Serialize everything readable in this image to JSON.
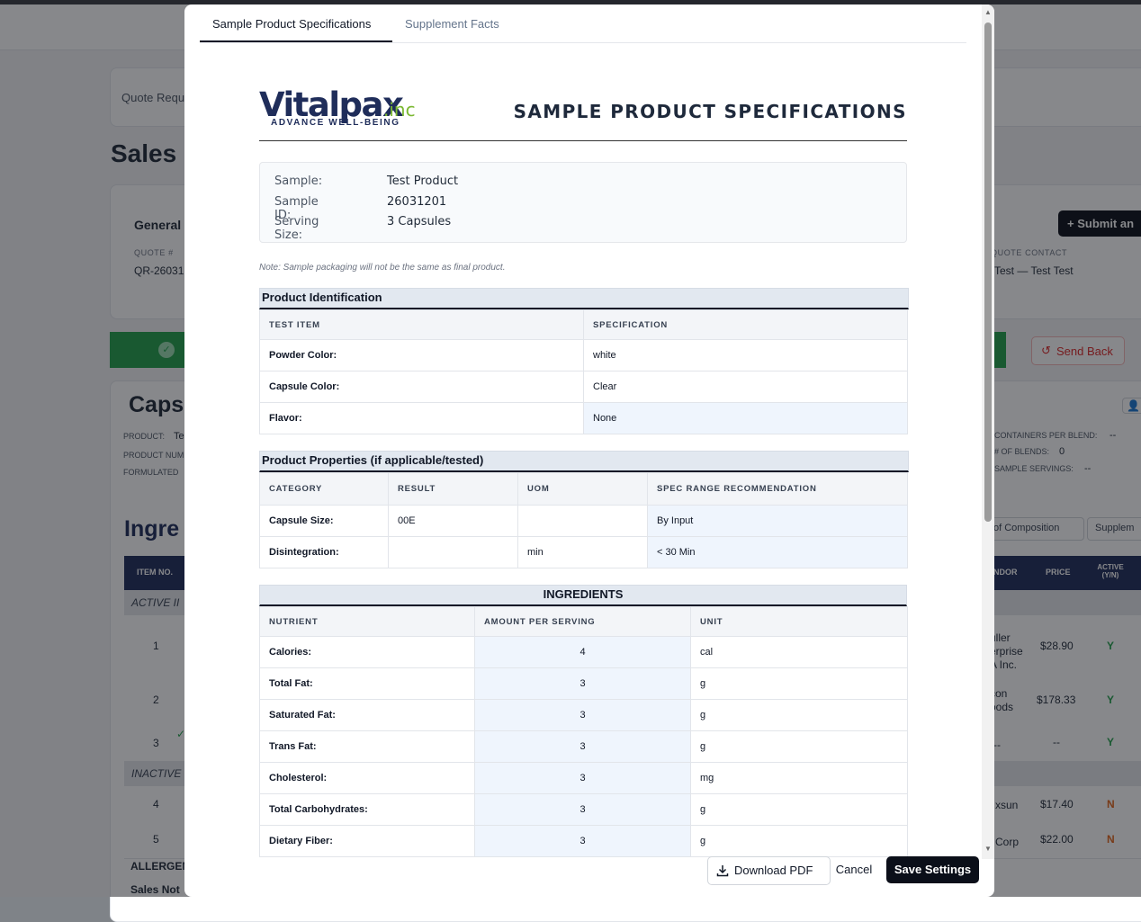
{
  "background": {
    "breadcrumb": "Quote Reque",
    "page_title": "Sales C",
    "general_label": "General",
    "quote_no_label": "QUOTE #",
    "quote_no_value": "QR-26031",
    "quote_contact_label": "QUOTE CONTACT",
    "quote_contact_value": "Test — Test Test",
    "submit_button": "+ Submit an",
    "send_back_button": "Send Back",
    "caps_title": "Caps",
    "product_label": "PRODUCT:",
    "product_value": "Te",
    "product_num_label": "PRODUCT NUM",
    "formulated_label": "FORMULATED",
    "containers_label": "CONTAINERS PER BLEND:",
    "containers_value": "--",
    "blends_label": "# OF BLENDS:",
    "blends_value": "0",
    "sample_servings_label": "SAMPLE SERVINGS:",
    "sample_servings_value": "--",
    "ingredients_title": "Ingre",
    "composition_btn": "of Composition",
    "supplement_btn": "Supplem",
    "col_item_no": "ITEM NO.",
    "col_vendor": "NDOR",
    "col_price": "PRICE",
    "col_active": "ACTIVE (Y/N)",
    "active_group": "ACTIVE II",
    "inactive_group": "INACTIVE",
    "rows": [
      {
        "no": "1",
        "vendor": "uller erprise A Inc.",
        "price": "$28.90",
        "active": "Y"
      },
      {
        "no": "2",
        "vendor": "con oods",
        "price": "$178.33",
        "active": "Y"
      },
      {
        "no": "3",
        "vendor": "--",
        "price": "--",
        "active": "Y"
      },
      {
        "no": "4",
        "vendor": "xsun",
        "price": "$17.40",
        "active": "N"
      },
      {
        "no": "5",
        "vendor": "Corp",
        "price": "$22.00",
        "active": "N"
      }
    ],
    "allergen_label": "ALLERGEN",
    "sales_notes_label": "Sales Not"
  },
  "modal": {
    "tabs": [
      {
        "label": "Sample Product Specifications",
        "active": true
      },
      {
        "label": "Supplement Facts",
        "active": false
      }
    ],
    "logo_main": "Vitalpax",
    "logo_inc": ".inc",
    "logo_tagline": "ADVANCE WELL-BEING",
    "doc_title": "SAMPLE PRODUCT SPECIFICATIONS",
    "info": [
      {
        "label": "Sample:",
        "value": "Test Product"
      },
      {
        "label": "Sample ID:",
        "value": "26031201"
      },
      {
        "label": "Serving Size:",
        "value": "3 Capsules"
      }
    ],
    "note": "Note: Sample packaging will not be the same as final product.",
    "product_identification": {
      "title": "Product Identification",
      "headers": [
        "TEST ITEM",
        "SPECIFICATION"
      ],
      "rows": [
        [
          "Powder Color:",
          "white"
        ],
        [
          "Capsule Color:",
          "Clear"
        ],
        [
          "Flavor:",
          "None"
        ]
      ]
    },
    "product_properties": {
      "title": "Product Properties (if applicable/tested)",
      "headers": [
        "CATEGORY",
        "RESULT",
        "UOM",
        "SPEC RANGE RECOMMENDATION"
      ],
      "rows": [
        [
          "Capsule Size:",
          "00E",
          "",
          "By Input"
        ],
        [
          "Disintegration:",
          "",
          "min",
          "< 30 Min"
        ]
      ]
    },
    "ingredients": {
      "title": "INGREDIENTS",
      "headers": [
        "NUTRIENT",
        "AMOUNT PER SERVING",
        "UNIT"
      ],
      "rows": [
        [
          "Calories:",
          "4",
          "cal"
        ],
        [
          "Total Fat:",
          "3",
          "g"
        ],
        [
          "Saturated Fat:",
          "3",
          "g"
        ],
        [
          "Trans Fat:",
          "3",
          "g"
        ],
        [
          "Cholesterol:",
          "3",
          "mg"
        ],
        [
          "Total Carbohydrates:",
          "3",
          "g"
        ],
        [
          "Dietary Fiber:",
          "3",
          "g"
        ]
      ]
    },
    "buttons": {
      "download_pdf": "Download PDF",
      "cancel": "Cancel",
      "save": "Save Settings"
    }
  },
  "colors": {
    "brand_navy": "#1f2d5a",
    "brand_green": "#7bb832",
    "primary_button": "#0b0f19",
    "send_back_red": "#dc2626",
    "success_green": "#22a04b"
  }
}
